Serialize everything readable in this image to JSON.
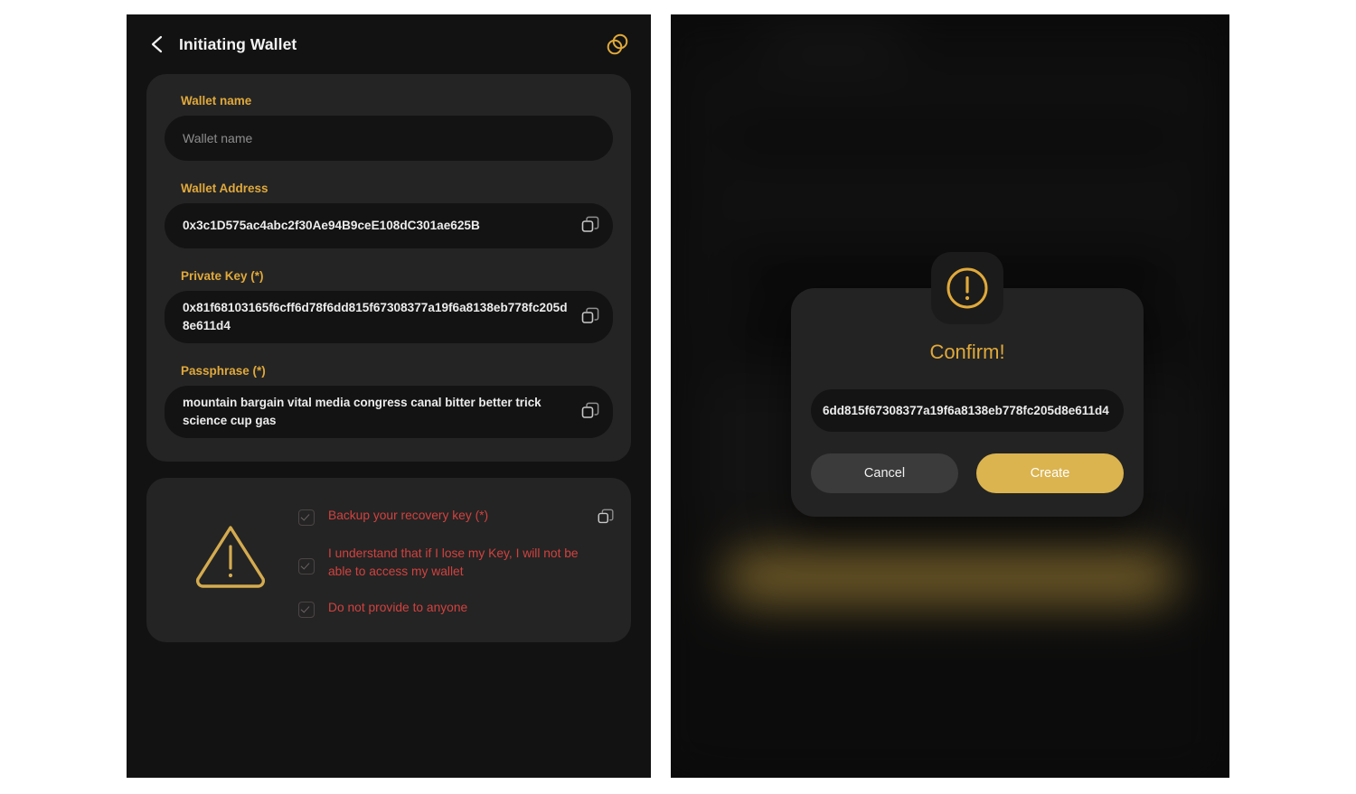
{
  "theme": {
    "page_bg": "#ffffff",
    "panel_bg": "#121212",
    "card_bg": "#242424",
    "input_bg": "#131313",
    "gold": "#e0a93b",
    "gold_button": "#dbb44f",
    "danger_red": "#d2423f",
    "text_primary": "#ececec",
    "placeholder": "#8d8d8d"
  },
  "left_screen": {
    "header": {
      "back_icon": "chevron-left-icon",
      "title": "Initiating Wallet",
      "action_icon": "overlapping-rings-icon"
    },
    "form": {
      "fields": [
        {
          "label": "Wallet name",
          "value": "",
          "placeholder": "Wallet name",
          "copyable": false
        },
        {
          "label": "Wallet Address",
          "value": "0x3c1D575ac4abc2f30Ae94B9ceE108dC301ae625B",
          "placeholder": "",
          "copyable": true
        },
        {
          "label": "Private Key (*)",
          "value": "0x81f68103165f6cff6d78f6dd815f67308377a19f6a8138eb778fc205d8e611d4",
          "placeholder": "",
          "copyable": true
        },
        {
          "label": "Passphrase (*)",
          "value": "mountain bargain vital media congress canal bitter better trick science cup gas",
          "placeholder": "",
          "copyable": true
        }
      ]
    },
    "warning": {
      "icon": "warning-triangle-icon",
      "items": [
        {
          "text": "Backup your recovery key (*)",
          "checked": true,
          "has_copy": true
        },
        {
          "text": "I understand that if I lose my Key, I will not be able to access my wallet",
          "checked": true,
          "has_copy": false
        },
        {
          "text": "Do not provide to anyone",
          "checked": true,
          "has_copy": false
        }
      ]
    }
  },
  "right_screen": {
    "modal": {
      "badge_icon": "alert-circle-icon",
      "title": "Confirm!",
      "key_value": "6dd815f67308377a19f6a8138eb778fc205d8e611d4",
      "cancel_label": "Cancel",
      "create_label": "Create"
    }
  }
}
